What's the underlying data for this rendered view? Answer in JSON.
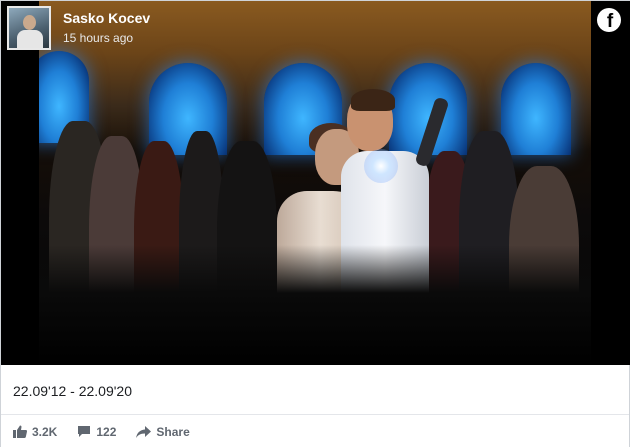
{
  "post": {
    "author_name": "Sasko Kocev",
    "timestamp": "15 hours ago",
    "caption": "22.09'12 - 22.09'20"
  },
  "stats": {
    "likes": "3.2K",
    "comments": "122",
    "share_label": "Share"
  },
  "icons": {
    "brand": "facebook-icon",
    "like": "like-icon",
    "comment": "comment-icon",
    "share": "share-icon"
  },
  "colors": {
    "stage_light": "#2f9bff",
    "action_text": "#606770"
  }
}
